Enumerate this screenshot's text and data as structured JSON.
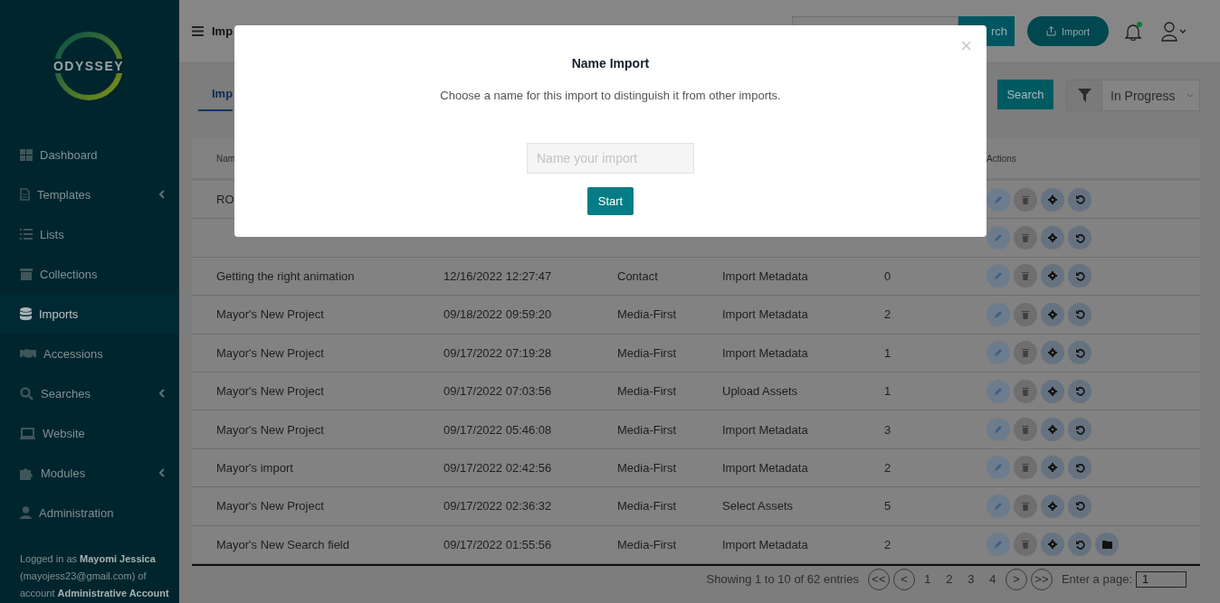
{
  "sidebar": {
    "logo_text": "ODYSSEY",
    "items": [
      {
        "label": "Dashboard",
        "selected": false,
        "has_submenu": false
      },
      {
        "label": "Templates",
        "selected": false,
        "has_submenu": true
      },
      {
        "label": "Lists",
        "selected": false,
        "has_submenu": false
      },
      {
        "label": "Collections",
        "selected": false,
        "has_submenu": false
      },
      {
        "label": "Imports",
        "selected": true,
        "has_submenu": false
      },
      {
        "label": "Accessions",
        "selected": false,
        "has_submenu": false
      },
      {
        "label": "Searches",
        "selected": false,
        "has_submenu": true
      },
      {
        "label": "Website",
        "selected": false,
        "has_submenu": false
      },
      {
        "label": "Modules",
        "selected": false,
        "has_submenu": true
      },
      {
        "label": "Administration",
        "selected": false,
        "has_submenu": false
      }
    ],
    "footer": "Logged in as **Mayomi Jessica** (mayojess23@gmail.com) of account **Administrative Account**"
  },
  "header": {
    "page_title": "Imp",
    "search_button": "rch",
    "import_button": "Import",
    "notification_dot": true
  },
  "tabs": [
    {
      "label": "Imp",
      "selected": true
    }
  ],
  "filter": {
    "search_button": "Search",
    "status": "In Progress"
  },
  "table": {
    "columns": {
      "column_1": "Nam",
      "column_6": "Actions"
    },
    "rows": [
      {
        "name": "RO",
        "actions": [
          {
            "kind": "edit"
          },
          {
            "kind": "delete"
          },
          {
            "kind": "settings"
          },
          {
            "kind": "undo"
          }
        ]
      },
      {
        "actions": [
          {
            "kind": "edit"
          },
          {
            "kind": "delete"
          },
          {
            "kind": "settings"
          },
          {
            "kind": "undo"
          }
        ]
      },
      {
        "name": "Getting the right animation",
        "date": "12/16/2022 12:27:47",
        "type": "Contact",
        "step": "Import Metadata",
        "count": "0",
        "actions": [
          {
            "kind": "edit"
          },
          {
            "kind": "delete"
          },
          {
            "kind": "settings"
          },
          {
            "kind": "undo"
          }
        ]
      },
      {
        "name": "Mayor's New Project",
        "date": "09/18/2022 09:59:20",
        "type": "Media-First",
        "step": "Import Metadata",
        "count": "2",
        "actions": [
          {
            "kind": "edit"
          },
          {
            "kind": "delete"
          },
          {
            "kind": "settings"
          },
          {
            "kind": "undo"
          }
        ]
      },
      {
        "name": "Mayor's New Project",
        "date": "09/17/2022 07:19:28",
        "type": "Media-First",
        "step": "Import Metadata",
        "count": "1",
        "actions": [
          {
            "kind": "edit"
          },
          {
            "kind": "delete"
          },
          {
            "kind": "settings"
          },
          {
            "kind": "undo"
          }
        ]
      },
      {
        "name": "Mayor's New Project",
        "date": "09/17/2022 07:03:56",
        "type": "Media-First",
        "step": "Upload Assets",
        "count": "1",
        "actions": [
          {
            "kind": "edit"
          },
          {
            "kind": "delete"
          },
          {
            "kind": "settings"
          },
          {
            "kind": "undo"
          }
        ]
      },
      {
        "name": "Mayor's New Project",
        "date": "09/17/2022 05:46:08",
        "type": "Media-First",
        "step": "Import Metadata",
        "count": "3",
        "actions": [
          {
            "kind": "edit"
          },
          {
            "kind": "delete"
          },
          {
            "kind": "settings"
          },
          {
            "kind": "undo"
          }
        ]
      },
      {
        "name": "Mayor's import",
        "date": "09/17/2022 02:42:56",
        "type": "Media-First",
        "step": "Import Metadata",
        "count": "2",
        "actions": [
          {
            "kind": "edit"
          },
          {
            "kind": "delete"
          },
          {
            "kind": "settings"
          },
          {
            "kind": "undo"
          }
        ]
      },
      {
        "name": "Mayor's New Project",
        "date": "09/17/2022 02:36:32",
        "type": "Media-First",
        "step": "Select Assets",
        "count": "5",
        "actions": [
          {
            "kind": "edit"
          },
          {
            "kind": "delete"
          },
          {
            "kind": "settings"
          },
          {
            "kind": "undo"
          }
        ]
      },
      {
        "name": "Mayor's New Search field",
        "date": "09/17/2022 01:55:56",
        "type": "Media-First",
        "step": "Import Metadata",
        "count": "2",
        "actions": [
          {
            "kind": "edit"
          },
          {
            "kind": "delete"
          },
          {
            "kind": "settings"
          },
          {
            "kind": "undo"
          },
          {
            "kind": "folder"
          }
        ]
      }
    ]
  },
  "pagination": {
    "summary": "Showing 1 to 10 of 62 entries",
    "buttons": [
      "<<",
      "<",
      "1",
      "2",
      "3",
      "4",
      ">",
      ">>"
    ],
    "page_label": "Enter a page:",
    "page_value": "1"
  },
  "modal": {
    "title": "Name Import",
    "subtitle": "Choose a name for this import to distinguish it from other imports.",
    "placeholder": "Name your import",
    "start_button": "Start",
    "close": "×"
  }
}
